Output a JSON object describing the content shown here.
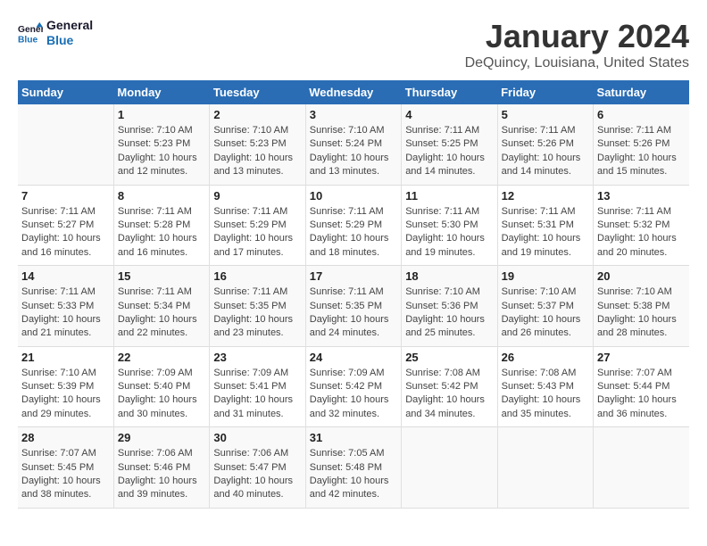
{
  "logo": {
    "line1": "General",
    "line2": "Blue"
  },
  "title": "January 2024",
  "subtitle": "DeQuincy, Louisiana, United States",
  "header_days": [
    "Sunday",
    "Monday",
    "Tuesday",
    "Wednesday",
    "Thursday",
    "Friday",
    "Saturday"
  ],
  "weeks": [
    [
      {
        "day": "",
        "sunrise": "",
        "sunset": "",
        "daylight": ""
      },
      {
        "day": "1",
        "sunrise": "Sunrise: 7:10 AM",
        "sunset": "Sunset: 5:23 PM",
        "daylight": "Daylight: 10 hours and 12 minutes."
      },
      {
        "day": "2",
        "sunrise": "Sunrise: 7:10 AM",
        "sunset": "Sunset: 5:23 PM",
        "daylight": "Daylight: 10 hours and 13 minutes."
      },
      {
        "day": "3",
        "sunrise": "Sunrise: 7:10 AM",
        "sunset": "Sunset: 5:24 PM",
        "daylight": "Daylight: 10 hours and 13 minutes."
      },
      {
        "day": "4",
        "sunrise": "Sunrise: 7:11 AM",
        "sunset": "Sunset: 5:25 PM",
        "daylight": "Daylight: 10 hours and 14 minutes."
      },
      {
        "day": "5",
        "sunrise": "Sunrise: 7:11 AM",
        "sunset": "Sunset: 5:26 PM",
        "daylight": "Daylight: 10 hours and 14 minutes."
      },
      {
        "day": "6",
        "sunrise": "Sunrise: 7:11 AM",
        "sunset": "Sunset: 5:26 PM",
        "daylight": "Daylight: 10 hours and 15 minutes."
      }
    ],
    [
      {
        "day": "7",
        "sunrise": "Sunrise: 7:11 AM",
        "sunset": "Sunset: 5:27 PM",
        "daylight": "Daylight: 10 hours and 16 minutes."
      },
      {
        "day": "8",
        "sunrise": "Sunrise: 7:11 AM",
        "sunset": "Sunset: 5:28 PM",
        "daylight": "Daylight: 10 hours and 16 minutes."
      },
      {
        "day": "9",
        "sunrise": "Sunrise: 7:11 AM",
        "sunset": "Sunset: 5:29 PM",
        "daylight": "Daylight: 10 hours and 17 minutes."
      },
      {
        "day": "10",
        "sunrise": "Sunrise: 7:11 AM",
        "sunset": "Sunset: 5:29 PM",
        "daylight": "Daylight: 10 hours and 18 minutes."
      },
      {
        "day": "11",
        "sunrise": "Sunrise: 7:11 AM",
        "sunset": "Sunset: 5:30 PM",
        "daylight": "Daylight: 10 hours and 19 minutes."
      },
      {
        "day": "12",
        "sunrise": "Sunrise: 7:11 AM",
        "sunset": "Sunset: 5:31 PM",
        "daylight": "Daylight: 10 hours and 19 minutes."
      },
      {
        "day": "13",
        "sunrise": "Sunrise: 7:11 AM",
        "sunset": "Sunset: 5:32 PM",
        "daylight": "Daylight: 10 hours and 20 minutes."
      }
    ],
    [
      {
        "day": "14",
        "sunrise": "Sunrise: 7:11 AM",
        "sunset": "Sunset: 5:33 PM",
        "daylight": "Daylight: 10 hours and 21 minutes."
      },
      {
        "day": "15",
        "sunrise": "Sunrise: 7:11 AM",
        "sunset": "Sunset: 5:34 PM",
        "daylight": "Daylight: 10 hours and 22 minutes."
      },
      {
        "day": "16",
        "sunrise": "Sunrise: 7:11 AM",
        "sunset": "Sunset: 5:35 PM",
        "daylight": "Daylight: 10 hours and 23 minutes."
      },
      {
        "day": "17",
        "sunrise": "Sunrise: 7:11 AM",
        "sunset": "Sunset: 5:35 PM",
        "daylight": "Daylight: 10 hours and 24 minutes."
      },
      {
        "day": "18",
        "sunrise": "Sunrise: 7:10 AM",
        "sunset": "Sunset: 5:36 PM",
        "daylight": "Daylight: 10 hours and 25 minutes."
      },
      {
        "day": "19",
        "sunrise": "Sunrise: 7:10 AM",
        "sunset": "Sunset: 5:37 PM",
        "daylight": "Daylight: 10 hours and 26 minutes."
      },
      {
        "day": "20",
        "sunrise": "Sunrise: 7:10 AM",
        "sunset": "Sunset: 5:38 PM",
        "daylight": "Daylight: 10 hours and 28 minutes."
      }
    ],
    [
      {
        "day": "21",
        "sunrise": "Sunrise: 7:10 AM",
        "sunset": "Sunset: 5:39 PM",
        "daylight": "Daylight: 10 hours and 29 minutes."
      },
      {
        "day": "22",
        "sunrise": "Sunrise: 7:09 AM",
        "sunset": "Sunset: 5:40 PM",
        "daylight": "Daylight: 10 hours and 30 minutes."
      },
      {
        "day": "23",
        "sunrise": "Sunrise: 7:09 AM",
        "sunset": "Sunset: 5:41 PM",
        "daylight": "Daylight: 10 hours and 31 minutes."
      },
      {
        "day": "24",
        "sunrise": "Sunrise: 7:09 AM",
        "sunset": "Sunset: 5:42 PM",
        "daylight": "Daylight: 10 hours and 32 minutes."
      },
      {
        "day": "25",
        "sunrise": "Sunrise: 7:08 AM",
        "sunset": "Sunset: 5:42 PM",
        "daylight": "Daylight: 10 hours and 34 minutes."
      },
      {
        "day": "26",
        "sunrise": "Sunrise: 7:08 AM",
        "sunset": "Sunset: 5:43 PM",
        "daylight": "Daylight: 10 hours and 35 minutes."
      },
      {
        "day": "27",
        "sunrise": "Sunrise: 7:07 AM",
        "sunset": "Sunset: 5:44 PM",
        "daylight": "Daylight: 10 hours and 36 minutes."
      }
    ],
    [
      {
        "day": "28",
        "sunrise": "Sunrise: 7:07 AM",
        "sunset": "Sunset: 5:45 PM",
        "daylight": "Daylight: 10 hours and 38 minutes."
      },
      {
        "day": "29",
        "sunrise": "Sunrise: 7:06 AM",
        "sunset": "Sunset: 5:46 PM",
        "daylight": "Daylight: 10 hours and 39 minutes."
      },
      {
        "day": "30",
        "sunrise": "Sunrise: 7:06 AM",
        "sunset": "Sunset: 5:47 PM",
        "daylight": "Daylight: 10 hours and 40 minutes."
      },
      {
        "day": "31",
        "sunrise": "Sunrise: 7:05 AM",
        "sunset": "Sunset: 5:48 PM",
        "daylight": "Daylight: 10 hours and 42 minutes."
      },
      {
        "day": "",
        "sunrise": "",
        "sunset": "",
        "daylight": ""
      },
      {
        "day": "",
        "sunrise": "",
        "sunset": "",
        "daylight": ""
      },
      {
        "day": "",
        "sunrise": "",
        "sunset": "",
        "daylight": ""
      }
    ]
  ]
}
